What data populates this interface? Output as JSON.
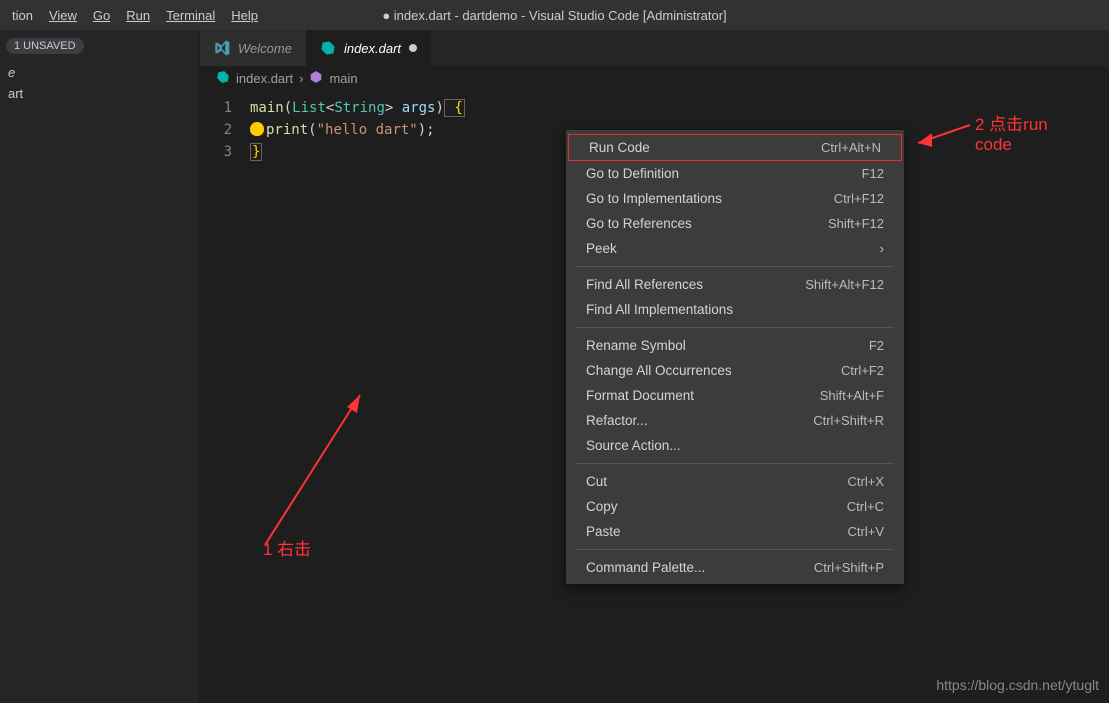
{
  "titlebar": {
    "title": "● index.dart - dartdemo - Visual Studio Code [Administrator]"
  },
  "menubar": {
    "items": [
      "tion",
      "View",
      "Go",
      "Run",
      "Terminal",
      "Help"
    ]
  },
  "sidebar": {
    "unsaved_badge": "1 UNSAVED",
    "items": [
      "e",
      "art"
    ]
  },
  "tabs": [
    {
      "label": "Welcome",
      "active": false,
      "dirty": false
    },
    {
      "label": "index.dart",
      "active": true,
      "dirty": true
    }
  ],
  "breadcrumb": {
    "file": "index.dart",
    "symbol": "main"
  },
  "code": {
    "line_numbers": [
      "1",
      "2",
      "3"
    ],
    "line1": {
      "fn": "main",
      "lp": "(",
      "type": "List",
      "lt": "<",
      "string_type": "String",
      "gt": ">",
      "sp": " ",
      "arg": "args",
      "rp": ")",
      "brace": " {"
    },
    "line2": {
      "indent": "  ",
      "fn": "print",
      "lp": "(",
      "str": "\"hello dart\"",
      "rp": ");"
    },
    "line3": {
      "brace": "}"
    }
  },
  "context_menu": {
    "items": [
      {
        "label": "Run Code",
        "shortcut": "Ctrl+Alt+N",
        "highlighted": true
      },
      {
        "label": "Go to Definition",
        "shortcut": "F12"
      },
      {
        "label": "Go to Implementations",
        "shortcut": "Ctrl+F12"
      },
      {
        "label": "Go to References",
        "shortcut": "Shift+F12"
      },
      {
        "label": "Peek",
        "submenu": true
      },
      {
        "sep": true
      },
      {
        "label": "Find All References",
        "shortcut": "Shift+Alt+F12"
      },
      {
        "label": "Find All Implementations"
      },
      {
        "sep": true
      },
      {
        "label": "Rename Symbol",
        "shortcut": "F2"
      },
      {
        "label": "Change All Occurrences",
        "shortcut": "Ctrl+F2"
      },
      {
        "label": "Format Document",
        "shortcut": "Shift+Alt+F"
      },
      {
        "label": "Refactor...",
        "shortcut": "Ctrl+Shift+R"
      },
      {
        "label": "Source Action..."
      },
      {
        "sep": true
      },
      {
        "label": "Cut",
        "shortcut": "Ctrl+X"
      },
      {
        "label": "Copy",
        "shortcut": "Ctrl+C"
      },
      {
        "label": "Paste",
        "shortcut": "Ctrl+V"
      },
      {
        "sep": true
      },
      {
        "label": "Command Palette...",
        "shortcut": "Ctrl+Shift+P"
      }
    ]
  },
  "annotations": {
    "a1": "1 右击",
    "a2_line1": "2 点击run",
    "a2_line2": "code"
  },
  "watermark": "https://blog.csdn.net/ytuglt"
}
